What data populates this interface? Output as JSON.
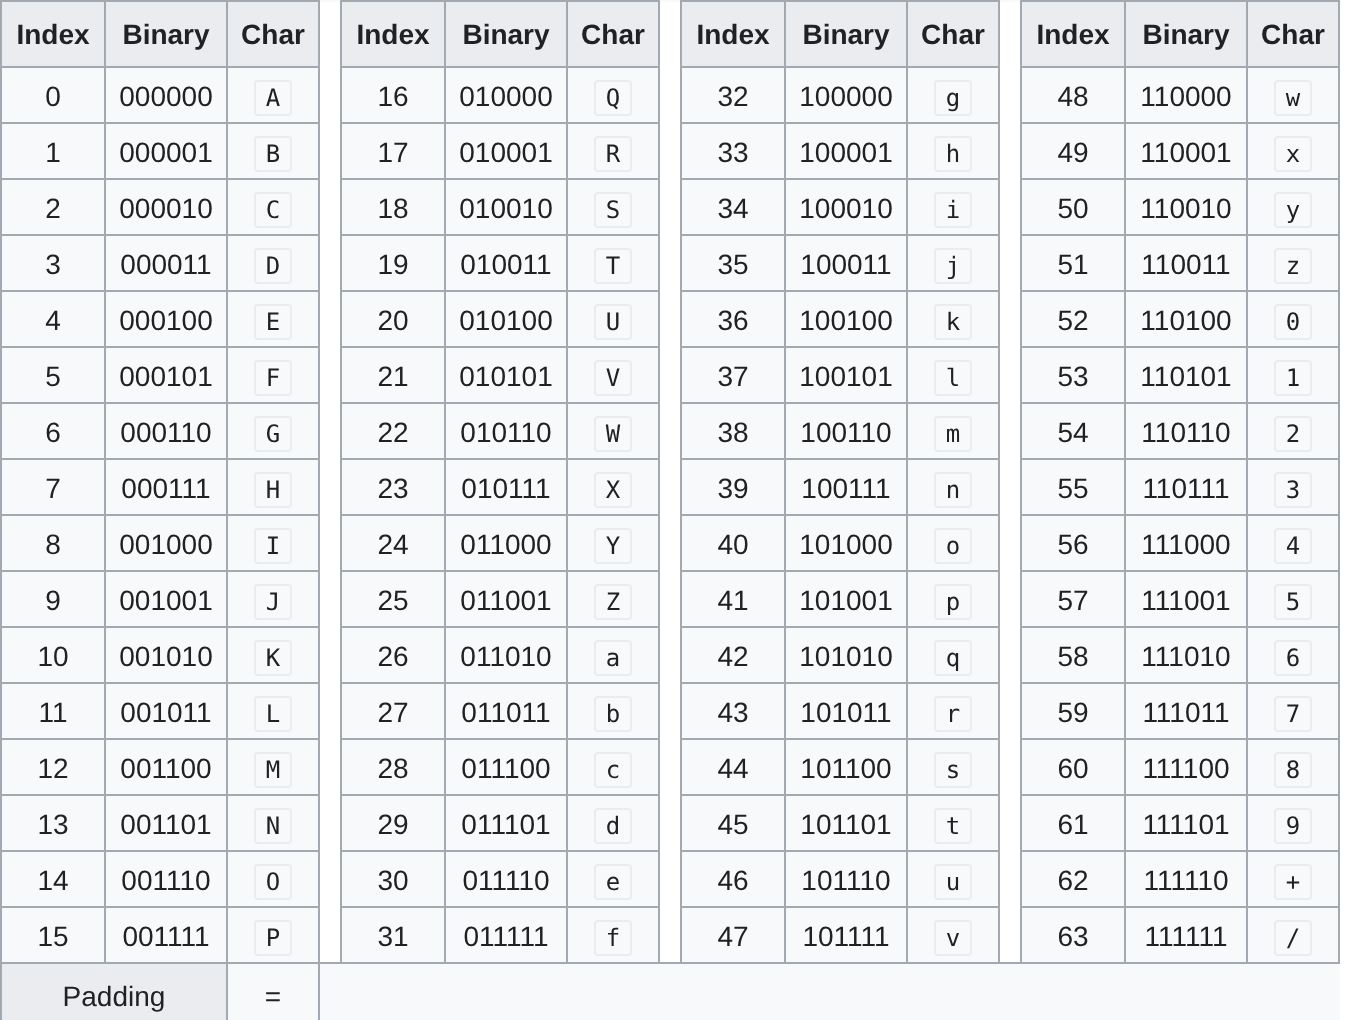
{
  "groups": [
    {
      "headers": [
        "Index",
        "Binary",
        "Char"
      ],
      "rows": [
        [
          "0",
          "000000",
          "A"
        ],
        [
          "1",
          "000001",
          "B"
        ],
        [
          "2",
          "000010",
          "C"
        ],
        [
          "3",
          "000011",
          "D"
        ],
        [
          "4",
          "000100",
          "E"
        ],
        [
          "5",
          "000101",
          "F"
        ],
        [
          "6",
          "000110",
          "G"
        ],
        [
          "7",
          "000111",
          "H"
        ],
        [
          "8",
          "001000",
          "I"
        ],
        [
          "9",
          "001001",
          "J"
        ],
        [
          "10",
          "001010",
          "K"
        ],
        [
          "11",
          "001011",
          "L"
        ],
        [
          "12",
          "001100",
          "M"
        ],
        [
          "13",
          "001101",
          "N"
        ],
        [
          "14",
          "001110",
          "O"
        ],
        [
          "15",
          "001111",
          "P"
        ]
      ]
    },
    {
      "headers": [
        "Index",
        "Binary",
        "Char"
      ],
      "rows": [
        [
          "16",
          "010000",
          "Q"
        ],
        [
          "17",
          "010001",
          "R"
        ],
        [
          "18",
          "010010",
          "S"
        ],
        [
          "19",
          "010011",
          "T"
        ],
        [
          "20",
          "010100",
          "U"
        ],
        [
          "21",
          "010101",
          "V"
        ],
        [
          "22",
          "010110",
          "W"
        ],
        [
          "23",
          "010111",
          "X"
        ],
        [
          "24",
          "011000",
          "Y"
        ],
        [
          "25",
          "011001",
          "Z"
        ],
        [
          "26",
          "011010",
          "a"
        ],
        [
          "27",
          "011011",
          "b"
        ],
        [
          "28",
          "011100",
          "c"
        ],
        [
          "29",
          "011101",
          "d"
        ],
        [
          "30",
          "011110",
          "e"
        ],
        [
          "31",
          "011111",
          "f"
        ]
      ]
    },
    {
      "headers": [
        "Index",
        "Binary",
        "Char"
      ],
      "rows": [
        [
          "32",
          "100000",
          "g"
        ],
        [
          "33",
          "100001",
          "h"
        ],
        [
          "34",
          "100010",
          "i"
        ],
        [
          "35",
          "100011",
          "j"
        ],
        [
          "36",
          "100100",
          "k"
        ],
        [
          "37",
          "100101",
          "l"
        ],
        [
          "38",
          "100110",
          "m"
        ],
        [
          "39",
          "100111",
          "n"
        ],
        [
          "40",
          "101000",
          "o"
        ],
        [
          "41",
          "101001",
          "p"
        ],
        [
          "42",
          "101010",
          "q"
        ],
        [
          "43",
          "101011",
          "r"
        ],
        [
          "44",
          "101100",
          "s"
        ],
        [
          "45",
          "101101",
          "t"
        ],
        [
          "46",
          "101110",
          "u"
        ],
        [
          "47",
          "101111",
          "v"
        ]
      ]
    },
    {
      "headers": [
        "Index",
        "Binary",
        "Char"
      ],
      "rows": [
        [
          "48",
          "110000",
          "w"
        ],
        [
          "49",
          "110001",
          "x"
        ],
        [
          "50",
          "110010",
          "y"
        ],
        [
          "51",
          "110011",
          "z"
        ],
        [
          "52",
          "110100",
          "0"
        ],
        [
          "53",
          "110101",
          "1"
        ],
        [
          "54",
          "110110",
          "2"
        ],
        [
          "55",
          "110111",
          "3"
        ],
        [
          "56",
          "111000",
          "4"
        ],
        [
          "57",
          "111001",
          "5"
        ],
        [
          "58",
          "111010",
          "6"
        ],
        [
          "59",
          "111011",
          "7"
        ],
        [
          "60",
          "111100",
          "8"
        ],
        [
          "61",
          "111101",
          "9"
        ],
        [
          "62",
          "111110",
          "+"
        ],
        [
          "63",
          "111111",
          "/"
        ]
      ]
    }
  ],
  "padding": {
    "label": "Padding",
    "char": "="
  }
}
